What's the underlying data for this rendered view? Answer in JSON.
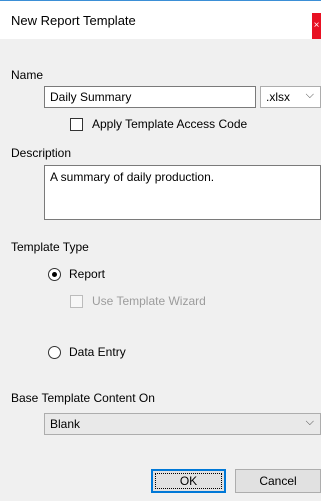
{
  "dialog": {
    "title": "New Report Template",
    "close_glyph": "×"
  },
  "name_section": {
    "label": "Name",
    "name_value": "Daily Summary",
    "extension_value": ".xlsx",
    "access_code_label": "Apply Template Access Code",
    "access_code_checked": false
  },
  "description_section": {
    "label": "Description",
    "value": "A summary of daily production."
  },
  "template_type": {
    "label": "Template Type",
    "options": [
      {
        "label": "Report",
        "selected": true
      },
      {
        "label": "Data Entry",
        "selected": false
      }
    ],
    "wizard_label": "Use Template Wizard",
    "wizard_enabled": false
  },
  "base_content": {
    "label": "Base Template Content On",
    "value": "Blank"
  },
  "buttons": {
    "ok_label": "OK",
    "cancel_label": "Cancel"
  },
  "icons": {
    "chevron": "chevron-down-icon",
    "close": "close-icon"
  }
}
